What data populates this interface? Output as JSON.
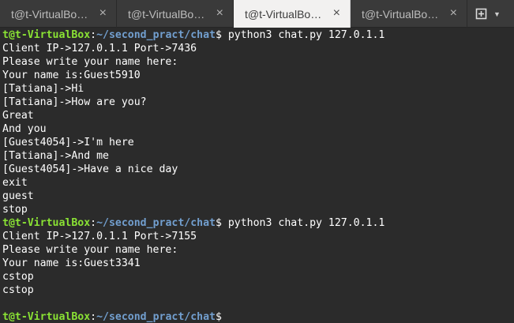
{
  "tabs": [
    {
      "label": "t@t-VirtualBo…",
      "active": false
    },
    {
      "label": "t@t-VirtualBo…",
      "active": false
    },
    {
      "label": "t@t-VirtualBo…",
      "active": true
    },
    {
      "label": "t@t-VirtualBo…",
      "active": false
    }
  ],
  "tab_close_glyph": "×",
  "new_tab_icon": "new-tab-plus-icon",
  "prompt": {
    "user_host": "t@t-VirtualBox",
    "colon": ":",
    "path": "~/second_pract/chat",
    "dollar": "$"
  },
  "terminal_lines": [
    {
      "type": "prompt",
      "command": " python3 chat.py 127.0.1.1"
    },
    {
      "type": "text",
      "text": "Client IP->127.0.1.1 Port->7436"
    },
    {
      "type": "text",
      "text": "Please write your name here:"
    },
    {
      "type": "text",
      "text": "Your name is:Guest5910"
    },
    {
      "type": "text",
      "text": "[Tatiana]->Hi"
    },
    {
      "type": "text",
      "text": "[Tatiana]->How are you?"
    },
    {
      "type": "text",
      "text": "Great"
    },
    {
      "type": "text",
      "text": "And you"
    },
    {
      "type": "text",
      "text": "[Guest4054]->I'm here"
    },
    {
      "type": "text",
      "text": "[Tatiana]->And me"
    },
    {
      "type": "text",
      "text": "[Guest4054]->Have a nice day"
    },
    {
      "type": "text",
      "text": "exit"
    },
    {
      "type": "text",
      "text": "guest"
    },
    {
      "type": "text",
      "text": "stop"
    },
    {
      "type": "prompt",
      "command": " python3 chat.py 127.0.1.1"
    },
    {
      "type": "text",
      "text": "Client IP->127.0.1.1 Port->7155"
    },
    {
      "type": "text",
      "text": "Please write your name here:"
    },
    {
      "type": "text",
      "text": "Your name is:Guest3341"
    },
    {
      "type": "text",
      "text": "cstop"
    },
    {
      "type": "text",
      "text": "cstop"
    },
    {
      "type": "text",
      "text": ""
    },
    {
      "type": "prompt",
      "command": ""
    }
  ],
  "colors": {
    "prompt_user": "#8ae234",
    "prompt_path": "#729fcf",
    "terminal_bg": "#2b2b2b",
    "text": "#ffffff"
  }
}
